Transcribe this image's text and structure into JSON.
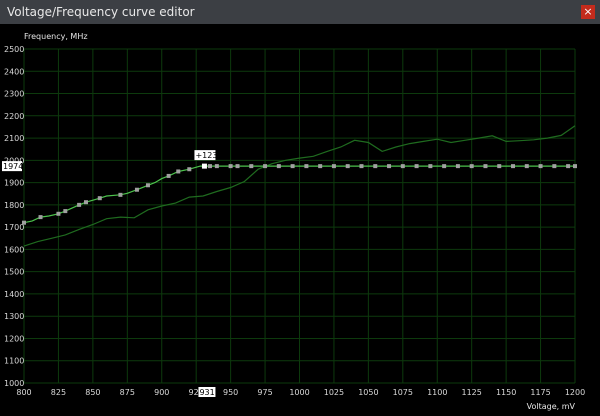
{
  "window": {
    "title": "Voltage/Frequency curve editor",
    "close_glyph": "×"
  },
  "chart_data": {
    "type": "line",
    "xlabel": "Voltage, mV",
    "ylabel": "Frequency, MHz",
    "xlim": [
      800,
      1200
    ],
    "ylim": [
      1000,
      2500
    ],
    "grid": true,
    "x_ticks": [
      800,
      825,
      850,
      875,
      900,
      925,
      950,
      975,
      1000,
      1025,
      1050,
      1075,
      1100,
      1125,
      1150,
      1175,
      1200
    ],
    "y_ticks": [
      1000,
      1100,
      1200,
      1300,
      1400,
      1500,
      1600,
      1700,
      1800,
      1900,
      2000,
      2100,
      2200,
      2300,
      2400,
      2500
    ],
    "series": [
      {
        "role": "default-curve",
        "color": "#1f6b1f",
        "x": [
          800,
          810,
          820,
          830,
          840,
          850,
          860,
          870,
          880,
          890,
          900,
          910,
          920,
          930,
          940,
          950,
          960,
          970,
          980,
          990,
          1000,
          1010,
          1020,
          1030,
          1040,
          1050,
          1060,
          1070,
          1080,
          1090,
          1100,
          1110,
          1120,
          1130,
          1140,
          1150,
          1160,
          1170,
          1180,
          1190,
          1200
        ],
        "values": [
          1615,
          1635,
          1650,
          1665,
          1690,
          1712,
          1738,
          1745,
          1742,
          1778,
          1795,
          1808,
          1835,
          1840,
          1860,
          1878,
          1905,
          1960,
          1985,
          2000,
          2010,
          2018,
          2040,
          2060,
          2090,
          2080,
          2040,
          2060,
          2075,
          2085,
          2095,
          2080,
          2090,
          2100,
          2110,
          2085,
          2088,
          2092,
          2100,
          2112,
          2155
        ]
      },
      {
        "role": "adjusted-curve",
        "color": "#4cc24c",
        "x": [
          800,
          806,
          812,
          818,
          825,
          830,
          840,
          845,
          855,
          860,
          870,
          875,
          882,
          890,
          895,
          900,
          905,
          912,
          920,
          928,
          935,
          940,
          945,
          950,
          955,
          960,
          965,
          970,
          975,
          980,
          985,
          990,
          995,
          1000,
          1005,
          1010,
          1015,
          1020,
          1025,
          1030,
          1035,
          1040,
          1045,
          1050,
          1055,
          1060,
          1065,
          1070,
          1075,
          1080,
          1085,
          1090,
          1095,
          1100,
          1105,
          1110,
          1115,
          1120,
          1125,
          1130,
          1135,
          1140,
          1145,
          1150,
          1155,
          1160,
          1165,
          1170,
          1175,
          1180,
          1185,
          1190,
          1195,
          1200
        ],
        "values": [
          1720,
          1728,
          1745,
          1750,
          1760,
          1772,
          1800,
          1812,
          1830,
          1840,
          1845,
          1852,
          1868,
          1888,
          1900,
          1918,
          1930,
          1950,
          1960,
          1974,
          1974,
          1974,
          1974,
          1974,
          1974,
          1974,
          1974,
          1974,
          1974,
          1974,
          1974,
          1974,
          1974,
          1974,
          1974,
          1974,
          1974,
          1974,
          1974,
          1974,
          1974,
          1974,
          1974,
          1974,
          1974,
          1974,
          1974,
          1974,
          1974,
          1974,
          1974,
          1974,
          1974,
          1974,
          1974,
          1974,
          1974,
          1974,
          1974,
          1974,
          1974,
          1974,
          1974,
          1974,
          1974,
          1974,
          1974,
          1974,
          1974,
          1974,
          1974,
          1974,
          1974,
          1974
        ],
        "points": [
          [
            800,
            1720
          ],
          [
            812,
            1745
          ],
          [
            825,
            1760
          ],
          [
            830,
            1772
          ],
          [
            840,
            1800
          ],
          [
            845,
            1812
          ],
          [
            855,
            1830
          ],
          [
            870,
            1845
          ],
          [
            882,
            1868
          ],
          [
            890,
            1888
          ],
          [
            905,
            1930
          ],
          [
            912,
            1950
          ],
          [
            920,
            1960
          ],
          [
            935,
            1974
          ],
          [
            940,
            1974
          ],
          [
            950,
            1974
          ],
          [
            955,
            1974
          ],
          [
            965,
            1974
          ],
          [
            975,
            1974
          ],
          [
            985,
            1974
          ],
          [
            995,
            1974
          ],
          [
            1005,
            1974
          ],
          [
            1015,
            1974
          ],
          [
            1025,
            1974
          ],
          [
            1035,
            1974
          ],
          [
            1045,
            1974
          ],
          [
            1055,
            1974
          ],
          [
            1065,
            1974
          ],
          [
            1075,
            1974
          ],
          [
            1085,
            1974
          ],
          [
            1095,
            1974
          ],
          [
            1105,
            1974
          ],
          [
            1115,
            1974
          ],
          [
            1125,
            1974
          ],
          [
            1135,
            1974
          ],
          [
            1145,
            1974
          ],
          [
            1155,
            1974
          ],
          [
            1165,
            1974
          ],
          [
            1175,
            1974
          ],
          [
            1185,
            1974
          ],
          [
            1195,
            1974
          ],
          [
            1200,
            1974
          ]
        ]
      }
    ],
    "selected_point": {
      "x": 931,
      "y": 1974,
      "offset_label": "+123",
      "x_readout": "931",
      "y_readout": "1974"
    }
  }
}
